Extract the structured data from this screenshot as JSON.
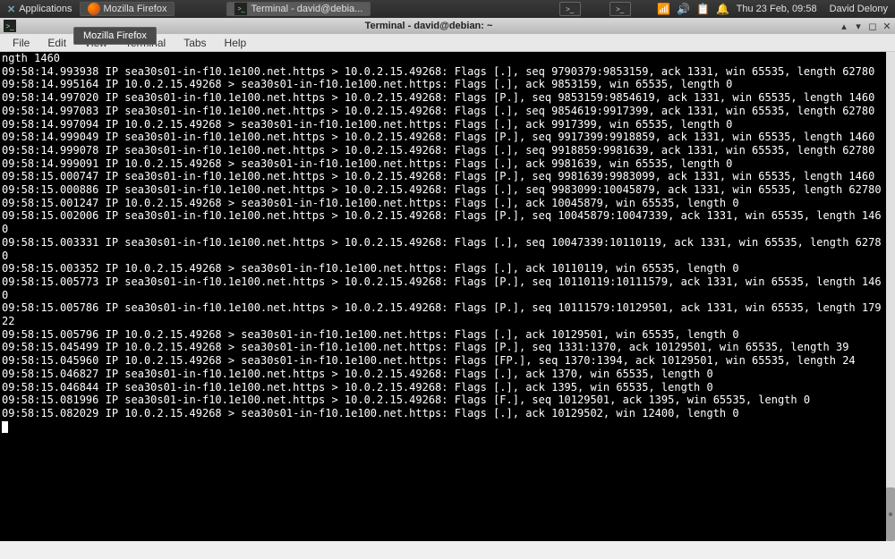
{
  "panel": {
    "applications_label": "Applications",
    "task_firefox": "Mozilla Firefox",
    "task_terminal": "Terminal - david@debia...",
    "clock": "Thu 23 Feb, 09:58",
    "username": "David Delony",
    "tooltip": "Mozilla Firefox"
  },
  "window": {
    "title": "Terminal - david@debian: ~",
    "menu": {
      "file": "File",
      "edit": "Edit",
      "view": "View",
      "terminal": "Terminal",
      "tabs": "Tabs",
      "help": "Help"
    }
  },
  "terminal_output": "ngth 1460\n09:58:14.993938 IP sea30s01-in-f10.1e100.net.https > 10.0.2.15.49268: Flags [.], seq 9790379:9853159, ack 1331, win 65535, length 62780\n09:58:14.995164 IP 10.0.2.15.49268 > sea30s01-in-f10.1e100.net.https: Flags [.], ack 9853159, win 65535, length 0\n09:58:14.997020 IP sea30s01-in-f10.1e100.net.https > 10.0.2.15.49268: Flags [P.], seq 9853159:9854619, ack 1331, win 65535, length 1460\n09:58:14.997083 IP sea30s01-in-f10.1e100.net.https > 10.0.2.15.49268: Flags [.], seq 9854619:9917399, ack 1331, win 65535, length 62780\n09:58:14.997094 IP 10.0.2.15.49268 > sea30s01-in-f10.1e100.net.https: Flags [.], ack 9917399, win 65535, length 0\n09:58:14.999049 IP sea30s01-in-f10.1e100.net.https > 10.0.2.15.49268: Flags [P.], seq 9917399:9918859, ack 1331, win 65535, length 1460\n09:58:14.999078 IP sea30s01-in-f10.1e100.net.https > 10.0.2.15.49268: Flags [.], seq 9918859:9981639, ack 1331, win 65535, length 62780\n09:58:14.999091 IP 10.0.2.15.49268 > sea30s01-in-f10.1e100.net.https: Flags [.], ack 9981639, win 65535, length 0\n09:58:15.000747 IP sea30s01-in-f10.1e100.net.https > 10.0.2.15.49268: Flags [P.], seq 9981639:9983099, ack 1331, win 65535, length 1460\n09:58:15.000886 IP sea30s01-in-f10.1e100.net.https > 10.0.2.15.49268: Flags [.], seq 9983099:10045879, ack 1331, win 65535, length 62780\n09:58:15.001247 IP 10.0.2.15.49268 > sea30s01-in-f10.1e100.net.https: Flags [.], ack 10045879, win 65535, length 0\n09:58:15.002006 IP sea30s01-in-f10.1e100.net.https > 10.0.2.15.49268: Flags [P.], seq 10045879:10047339, ack 1331, win 65535, length 1460\n09:58:15.003331 IP sea30s01-in-f10.1e100.net.https > 10.0.2.15.49268: Flags [.], seq 10047339:10110119, ack 1331, win 65535, length 62780\n09:58:15.003352 IP 10.0.2.15.49268 > sea30s01-in-f10.1e100.net.https: Flags [.], ack 10110119, win 65535, length 0\n09:58:15.005773 IP sea30s01-in-f10.1e100.net.https > 10.0.2.15.49268: Flags [P.], seq 10110119:10111579, ack 1331, win 65535, length 1460\n09:58:15.005786 IP sea30s01-in-f10.1e100.net.https > 10.0.2.15.49268: Flags [P.], seq 10111579:10129501, ack 1331, win 65535, length 17922\n09:58:15.005796 IP 10.0.2.15.49268 > sea30s01-in-f10.1e100.net.https: Flags [.], ack 10129501, win 65535, length 0\n09:58:15.045499 IP 10.0.2.15.49268 > sea30s01-in-f10.1e100.net.https: Flags [P.], seq 1331:1370, ack 10129501, win 65535, length 39\n09:58:15.045960 IP 10.0.2.15.49268 > sea30s01-in-f10.1e100.net.https: Flags [FP.], seq 1370:1394, ack 10129501, win 65535, length 24\n09:58:15.046827 IP sea30s01-in-f10.1e100.net.https > 10.0.2.15.49268: Flags [.], ack 1370, win 65535, length 0\n09:58:15.046844 IP sea30s01-in-f10.1e100.net.https > 10.0.2.15.49268: Flags [.], ack 1395, win 65535, length 0\n09:58:15.081996 IP sea30s01-in-f10.1e100.net.https > 10.0.2.15.49268: Flags [F.], seq 10129501, ack 1395, win 65535, length 0\n09:58:15.082029 IP 10.0.2.15.49268 > sea30s01-in-f10.1e100.net.https: Flags [.], ack 10129502, win 12400, length 0\n"
}
